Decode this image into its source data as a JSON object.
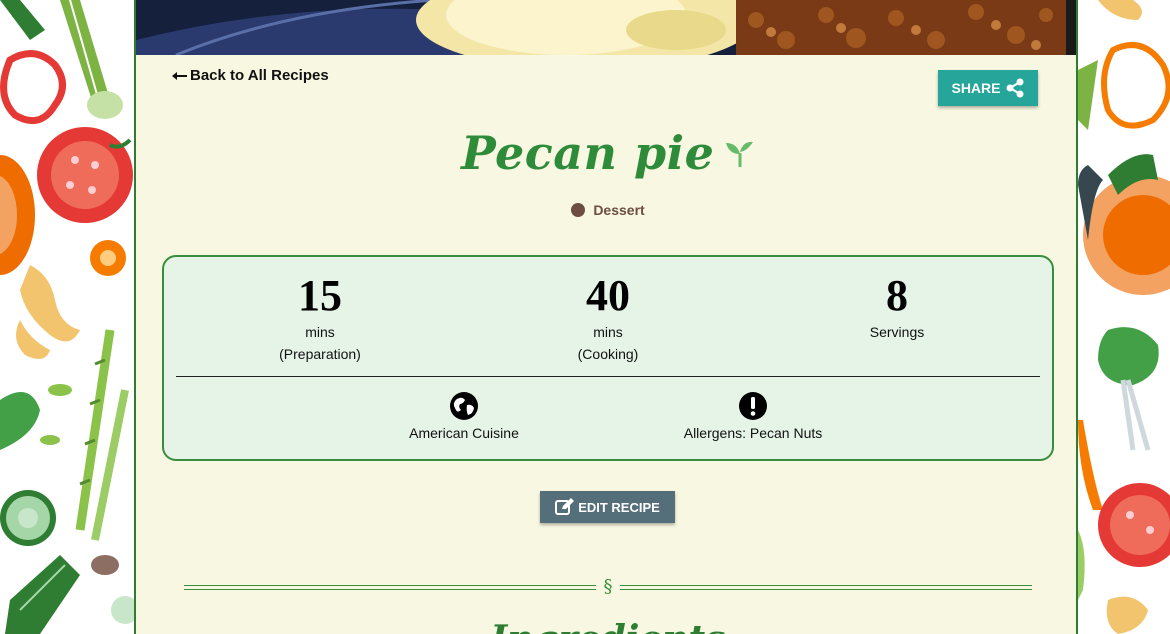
{
  "nav": {
    "back_label": "Back to All Recipes"
  },
  "share": {
    "label": "SHARE"
  },
  "recipe": {
    "title": "Pecan pie",
    "category": "Dessert",
    "category_color": "#6d4c41",
    "title_color": "#2e8b3a"
  },
  "stats": [
    {
      "value": "15",
      "unit": "mins",
      "detail": "(Preparation)"
    },
    {
      "value": "40",
      "unit": "mins",
      "detail": "(Cooking)"
    },
    {
      "value": "8",
      "unit": "Servings",
      "detail": ""
    }
  ],
  "meta": {
    "cuisine": "American Cuisine",
    "allergens": "Allergens: Pecan Nuts"
  },
  "edit": {
    "label": "EDIT RECIPE"
  },
  "section": {
    "symbol": "§",
    "heading": "Ingredients"
  },
  "colors": {
    "accent": "#26a69a",
    "edit_button": "#546e7a",
    "card_bg": "#f8f8e2",
    "info_bg": "#e6f4e8",
    "green": "#2e7d32"
  },
  "icons": {
    "back": "arrow-left-icon",
    "share": "share-icon",
    "sprout": "sprout-icon",
    "cuisine": "globe-icon",
    "allergens": "exclamation-circle-icon",
    "edit": "edit-icon"
  }
}
